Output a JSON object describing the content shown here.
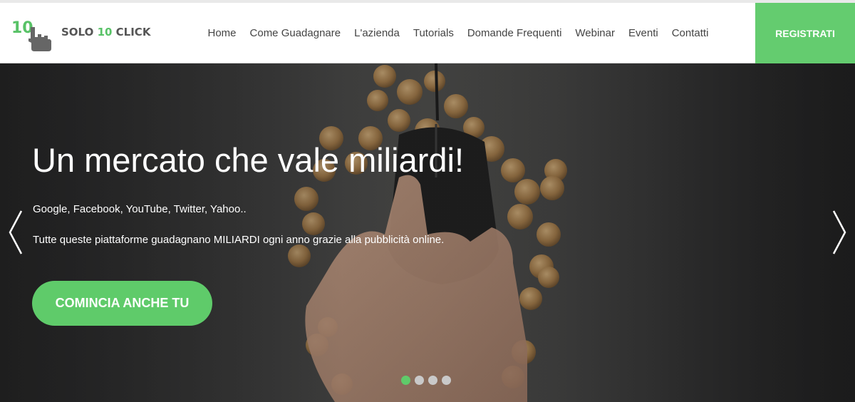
{
  "header": {
    "logo": {
      "number": "10",
      "text_prefix": "SOLO ",
      "text_number": "10",
      "text_suffix": " CLICK"
    },
    "nav": [
      {
        "label": "Home"
      },
      {
        "label": "Come Guadagnare"
      },
      {
        "label": "L'azienda"
      },
      {
        "label": "Tutorials"
      },
      {
        "label": "Domande Frequenti"
      },
      {
        "label": "Webinar"
      },
      {
        "label": "Eventi"
      },
      {
        "label": "Contatti"
      }
    ],
    "register_label": "REGISTRATI"
  },
  "hero": {
    "title": "Un mercato che vale miliardi!",
    "line1": "Google, Facebook, YouTube, Twitter, Yahoo..",
    "line2": "Tutte queste piattaforme guadagnano MILIARDI ogni anno grazie alla pubblicità online.",
    "cta_label": "COMINCIA ANCHE TU",
    "slides_total": 4,
    "active_slide": 1
  },
  "colors": {
    "brand_green": "#5fcb6a",
    "logo_gray": "#555555",
    "nav_text": "#444444"
  },
  "icons": [
    "logo-hand-icon",
    "chevron-left-icon",
    "chevron-right-icon"
  ]
}
